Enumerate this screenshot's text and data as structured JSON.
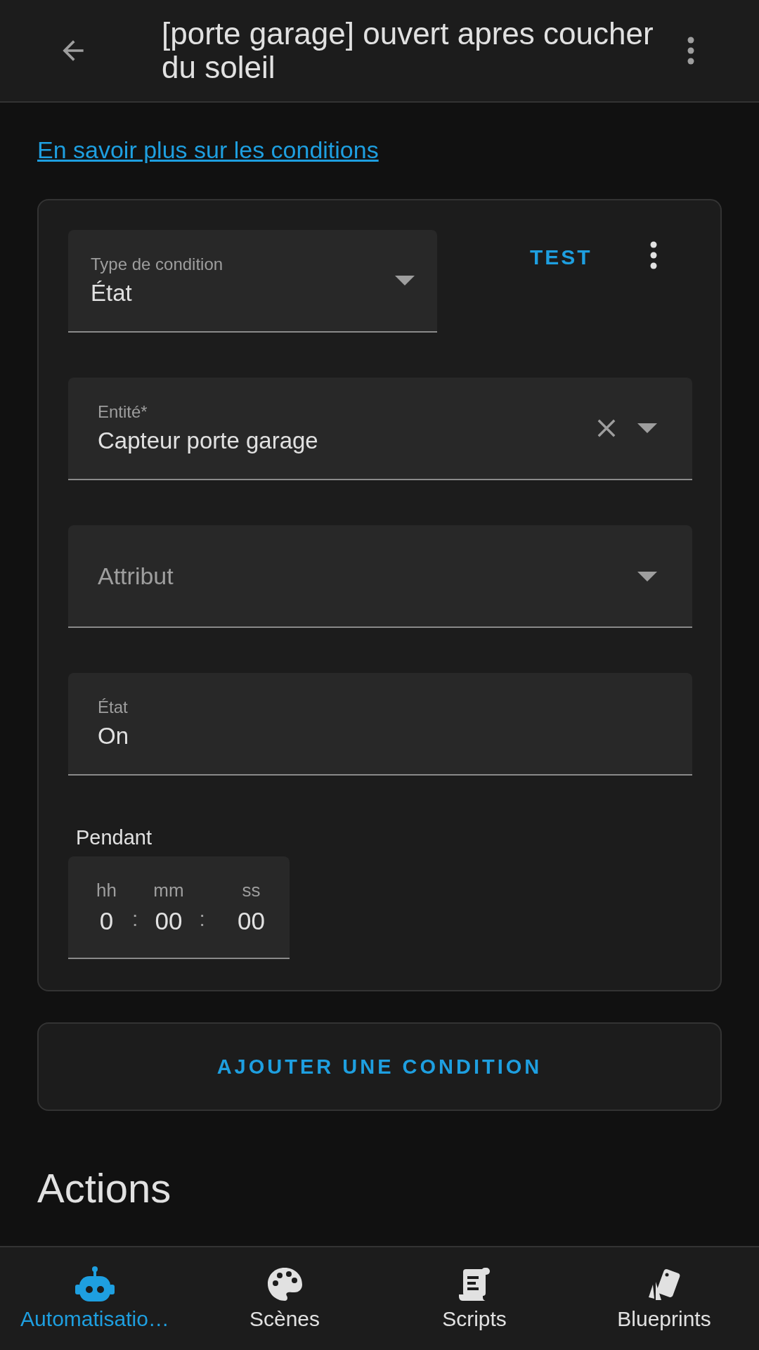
{
  "header": {
    "title": "[porte garage] ouvert apres coucher du soleil"
  },
  "intro": {
    "link": "En savoir plus sur les conditions"
  },
  "condition_card": {
    "type_field": {
      "label": "Type de condition",
      "value": "État"
    },
    "test_button": "TEST",
    "fields": [
      {
        "kind": "select",
        "label": "Entité*",
        "value": "Capteur porte garage",
        "clearable": true
      },
      {
        "kind": "select",
        "placeholder": "Attribut"
      },
      {
        "kind": "text",
        "label": "État",
        "value": "On"
      }
    ],
    "duration": {
      "label": "Pendant",
      "separator": ":",
      "units": [
        {
          "label": "hh",
          "value": "0"
        },
        {
          "label": "mm",
          "value": "00"
        },
        {
          "label": "ss",
          "value": "00"
        }
      ]
    }
  },
  "add_condition_button": "AJOUTER UNE CONDITION",
  "section_heading": "Actions",
  "bottom_nav": [
    {
      "label": "Automatisatio…",
      "selected": true
    },
    {
      "label": "Scènes",
      "selected": false
    },
    {
      "label": "Scripts",
      "selected": false
    },
    {
      "label": "Blueprints",
      "selected": false
    }
  ]
}
